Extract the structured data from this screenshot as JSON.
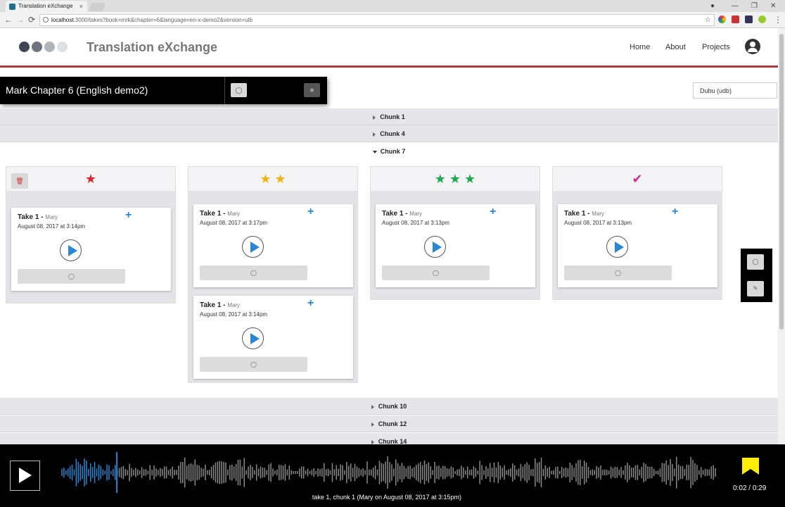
{
  "browser": {
    "tab_title": "Translation eXchange",
    "tab_close": "×",
    "url_host": "localhost",
    "url_rest": ":3000/takes?book=mrk&chapter=6&language=en-x-demo2&version=ulb",
    "back": "←",
    "forward": "→",
    "reload": "⟳",
    "star": "☆",
    "menu": "⋮",
    "min": "—",
    "max": "❐",
    "close": "✕"
  },
  "header": {
    "brand": "Translation eXchange",
    "nav": [
      "Home",
      "About",
      "Projects"
    ]
  },
  "titlebar": {
    "title": "Mark Chapter 6 (English demo2)",
    "comment_icon": "◯",
    "menu_icon": "≡"
  },
  "language_select": {
    "value": "Dubu (udb)"
  },
  "chunks_above": [
    "Chunk 1",
    "Chunk 4"
  ],
  "chunk_open": "Chunk 7",
  "columns": [
    {
      "head": "★",
      "head_color": "#d9262e",
      "delete": "🗑",
      "cards": [
        {
          "take": "Take 1 - ",
          "author": "Mary",
          "date": "August 08, 2017 at 3:14pm"
        }
      ]
    },
    {
      "head": "★ ★",
      "head_color": "#f0b412",
      "cards": [
        {
          "take": "Take 1 - ",
          "author": "Mary",
          "date": "August 08, 2017 at 3:17pm"
        },
        {
          "take": "Take 1 - ",
          "author": "Mary",
          "date": "August 08, 2017 at 3:14pm"
        }
      ]
    },
    {
      "head": "★ ★ ★",
      "head_color": "#1ea84a",
      "cards": [
        {
          "take": "Take 1 - ",
          "author": "Mary",
          "date": "August 08, 2017 at 3:13pm"
        }
      ]
    },
    {
      "head": "✔",
      "head_color": "#d0338a",
      "cards": [
        {
          "take": "Take 1 - ",
          "author": "Mary",
          "date": "August 08, 2017 at 3:13pm"
        }
      ]
    }
  ],
  "card_plus": "+",
  "card_comment": "◯",
  "chunks_below": [
    "Chunk 10",
    "Chunk 12",
    "Chunk 14"
  ],
  "side_panel": {
    "comment": "◯",
    "edit": "✎"
  },
  "player": {
    "time_current": "0:02",
    "time_sep": " / ",
    "time_total": "0:29",
    "caption": "take 1, chunk 1 (Mary on August 08, 2017 at 3:15pm)",
    "progress": 0.102
  },
  "colors": {
    "accent": "#2b86d4",
    "header_rule": "#b43a3a",
    "wave_played": "#2b86d4",
    "wave": "#8a8a8a"
  }
}
